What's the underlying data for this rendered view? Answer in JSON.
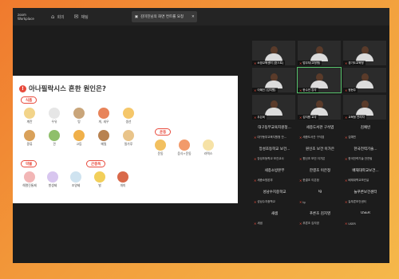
{
  "topbar": {
    "logo": "zoom Workplace",
    "btn1_label": "회의",
    "btn2_label": "채팅",
    "tab_label": "김미진님의 화면 컨트롤 요청",
    "tab_close": "✕"
  },
  "share": {
    "title": "아나필락시스 흔한 원인은?",
    "categories": [
      {
        "label": "식품"
      },
      {
        "label": "약물"
      },
      {
        "label": "곤충독"
      },
      {
        "label": "운동"
      }
    ],
    "food_items": [
      "계란",
      "우유",
      "땅",
      "게, 새우",
      "생선",
      "콩류",
      "견",
      "고등",
      "메밀",
      "밀가루"
    ],
    "drug_items": [
      "해열진통제",
      "항생제",
      "조영제"
    ],
    "insect_items": [
      "벌",
      "개미"
    ],
    "exercise_items": [
      "운동",
      "음식+운동",
      "라텍스"
    ]
  },
  "video_tiles": [
    {
      "name": "소방교육센터 (호스트)"
    },
    {
      "name": "법무부(교정청)"
    },
    {
      "name": "경기도교육청"
    },
    {
      "name": "이혜진 (김지원)"
    },
    {
      "name": "한수연 강사"
    },
    {
      "name": "정현주"
    },
    {
      "name": "우은희"
    },
    {
      "name": "김지원 교사"
    },
    {
      "name": "교육청 관리자"
    }
  ],
  "name_tiles": [
    {
      "big": "대구동부교육지원청...",
      "small": "대구동부교육지원청 안..."
    },
    {
      "big": "세종도서관 구석엽",
      "small": "세종도서관 구석엽"
    },
    {
      "big": "김예빈",
      "small": "김예빈"
    },
    {
      "big": "앙성초등학교 보건...",
      "small": "앙성초등학교 보건교사"
    },
    {
      "big": "원신초 보건 이가은",
      "small": "원신초 보건 이가은"
    },
    {
      "big": "한국전력기술...",
      "small": "한국전력기술 안전팀"
    },
    {
      "big": "세종소방본부",
      "small": "세종소방본부"
    },
    {
      "big": "한결초 이은정",
      "small": "한결초 이은정"
    },
    {
      "big": "배재대학교보건...",
      "small": "배재대학교보건실"
    },
    {
      "big": "성남수지중학교",
      "small": "성남수지중학교"
    },
    {
      "big": "lg",
      "small": "lg"
    },
    {
      "big": "늘푸른보건센터",
      "small": "늘푸른보건센터"
    },
    {
      "big": "새샘",
      "small": "새샘"
    },
    {
      "big": "푸른초 김지영",
      "small": "푸른초 김지영"
    },
    {
      "big": "USER",
      "small": "USER"
    }
  ],
  "colors": {
    "accent": "#e84a3c",
    "bg": "#f07a2e"
  }
}
